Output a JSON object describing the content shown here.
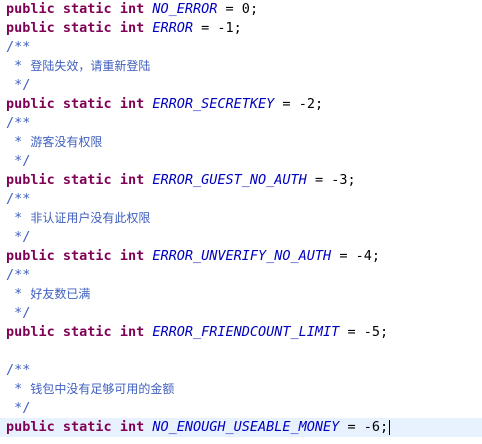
{
  "keywords": {
    "public": "public",
    "static": "static",
    "int": "int"
  },
  "constants": [
    {
      "name": "NO_ERROR",
      "value": "0"
    },
    {
      "name": "ERROR",
      "value": "-1"
    },
    {
      "name": "ERROR_SECRETKEY",
      "value": "-2",
      "comment": "登陆失效，请重新登陆"
    },
    {
      "name": "ERROR_GUEST_NO_AUTH",
      "value": "-3",
      "comment": "游客没有权限"
    },
    {
      "name": "ERROR_UNVERIFY_NO_AUTH",
      "value": "-4",
      "comment": "非认证用户没有此权限"
    },
    {
      "name": "ERROR_FRIENDCOUNT_LIMIT",
      "value": "-5",
      "comment": "好友数已满"
    },
    {
      "name": "NO_ENOUGH_USEABLE_MONEY",
      "value": "-6",
      "comment": "钱包中没有足够可用的金额"
    }
  ],
  "javadoc": {
    "open": "/**",
    "star": " *",
    "close": " */"
  },
  "symbols": {
    "assign": " = ",
    "end": ";"
  },
  "colors": {
    "keyword": "#7f0055",
    "field": "#0000c0",
    "comment": "#3f5fbf",
    "current_line": "#e8f2fe"
  }
}
